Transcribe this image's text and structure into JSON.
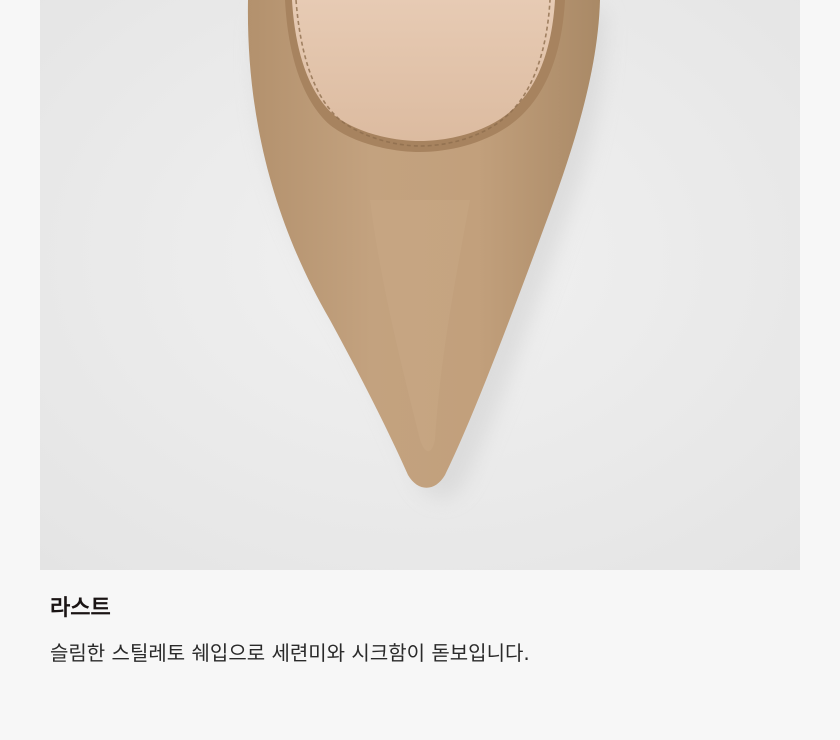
{
  "feature": {
    "title": "라스트",
    "description": "슬림한 스틸레토 쉐입으로 세련미와 시크함이 돋보입니다."
  },
  "image": {
    "subject": "shoe-toe-icon",
    "background_color": "#ececec",
    "suede_color": "#bf9f7c",
    "lining_color": "#e3c5ac"
  }
}
